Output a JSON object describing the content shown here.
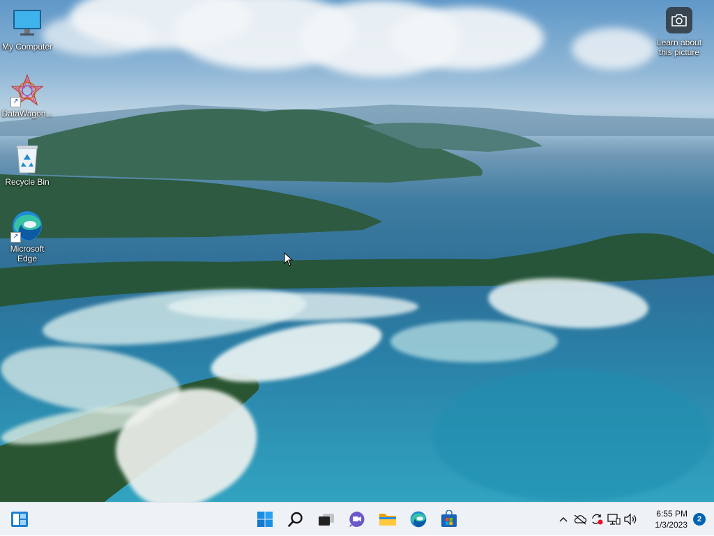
{
  "desktop": {
    "icons": [
      {
        "label": "My Computer",
        "icon": "monitor-icon"
      },
      {
        "label": "DataWagon...",
        "icon": "datawagon-app-icon"
      },
      {
        "label": "Recycle Bin",
        "icon": "recycle-bin-icon"
      },
      {
        "label": "Microsoft Edge",
        "icon": "edge-icon"
      }
    ],
    "spotlight": {
      "label": "Learn about this picture",
      "icon": "camera-icon"
    }
  },
  "taskbar": {
    "widgets_icon": "widgets-icon",
    "pinned": [
      {
        "name": "Start",
        "icon": "windows-start-icon"
      },
      {
        "name": "Search",
        "icon": "search-icon"
      },
      {
        "name": "Task View",
        "icon": "task-view-icon"
      },
      {
        "name": "Chat",
        "icon": "teams-chat-icon"
      },
      {
        "name": "File Explorer",
        "icon": "folder-icon"
      },
      {
        "name": "Microsoft Edge",
        "icon": "edge-icon"
      },
      {
        "name": "Microsoft Store",
        "icon": "store-icon"
      }
    ],
    "tray": {
      "icons": [
        "chevron-up-icon",
        "cloud-off-icon",
        "sync-error-icon",
        "network-icon",
        "volume-icon"
      ],
      "time": "6:55 PM",
      "date": "1/3/2023",
      "notification_count": "2"
    }
  },
  "colors": {
    "taskbar_bg": "#eef1f5",
    "accent": "#0063b1"
  }
}
